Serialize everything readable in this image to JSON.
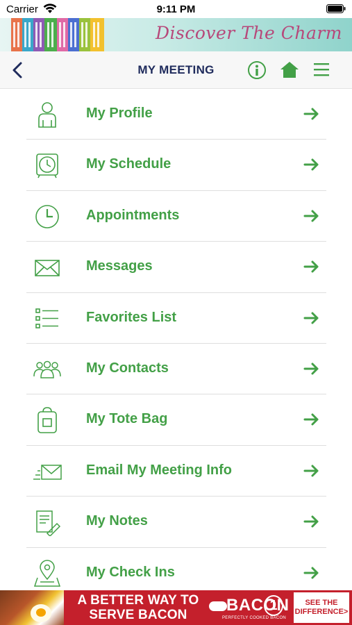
{
  "status_bar": {
    "carrier": "Carrier",
    "time": "9:11 PM",
    "icons": [
      "wifi-icon",
      "battery-icon"
    ]
  },
  "banner": {
    "tagline": "Discover The Charm",
    "colors": {
      "tagline": "#b7487a",
      "teal": "#8fd3cb",
      "houses": [
        "#e8734a",
        "#3aa7c9",
        "#8e5bb5",
        "#4cae4c",
        "#f2c12e",
        "#e06aa6",
        "#4b6fd1",
        "#9ac23c"
      ]
    }
  },
  "navbar": {
    "title": "MY MEETING",
    "icons": [
      "back-chevron-icon",
      "info-icon",
      "home-icon",
      "hamburger-menu-icon"
    ]
  },
  "menu": {
    "items": [
      {
        "label": "My Profile",
        "icon": "person-icon"
      },
      {
        "label": "My Schedule",
        "icon": "alarm-clock-icon"
      },
      {
        "label": "Appointments",
        "icon": "clock-icon"
      },
      {
        "label": "Messages",
        "icon": "envelope-icon"
      },
      {
        "label": "Favorites List",
        "icon": "checklist-icon"
      },
      {
        "label": "My Contacts",
        "icon": "people-group-icon"
      },
      {
        "label": "My Tote Bag",
        "icon": "tote-bag-icon"
      },
      {
        "label": "Email My Meeting Info",
        "icon": "send-email-icon"
      },
      {
        "label": "My Notes",
        "icon": "notes-pencil-icon"
      },
      {
        "label": "My Check Ins",
        "icon": "map-pin-icon"
      }
    ]
  },
  "ad": {
    "headline": "A BETTER WAY TO SERVE BACON",
    "brand": "BACON",
    "brand_number": "1",
    "brand_tagline": "PERFECTLY COOKED BACON",
    "cta": "SEE THE DIFFERENCE>"
  },
  "colors": {
    "accent_green": "#43a047",
    "title_navy": "#1f2b5c",
    "ad_red": "#c4202c"
  }
}
